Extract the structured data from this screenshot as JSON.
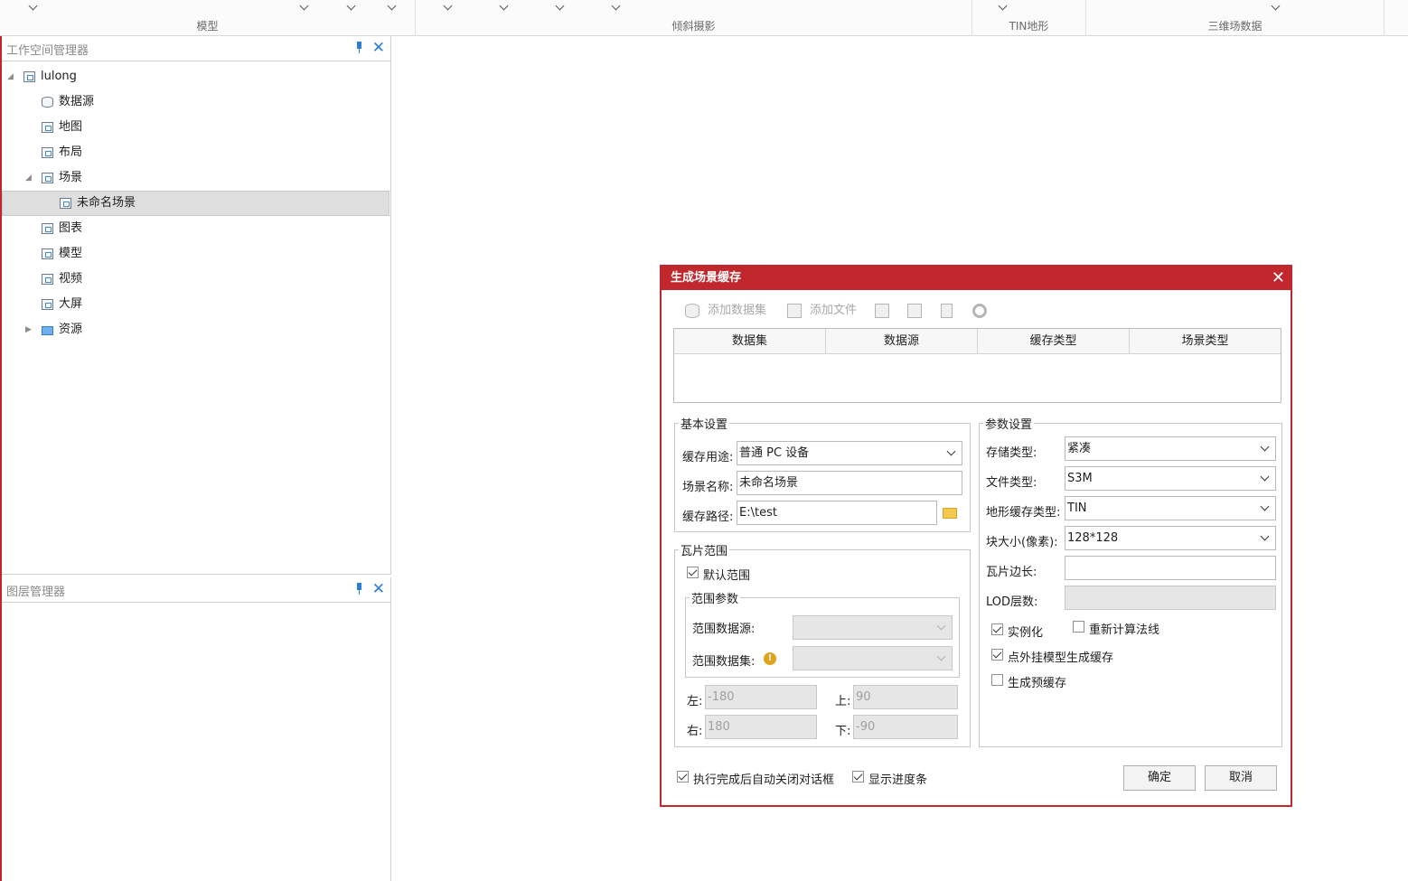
{
  "ribbon": {
    "groups": [
      {
        "label": "模型"
      },
      {
        "label": "倾斜摄影"
      },
      {
        "label": "TIN地形"
      },
      {
        "label": "三维场数据"
      }
    ]
  },
  "workspace_panel": {
    "title": "工作空间管理器",
    "items": [
      {
        "label": "lulong"
      },
      {
        "label": "数据源"
      },
      {
        "label": "地图"
      },
      {
        "label": "布局"
      },
      {
        "label": "场景"
      },
      {
        "label": "未命名场景"
      },
      {
        "label": "图表"
      },
      {
        "label": "模型"
      },
      {
        "label": "视频"
      },
      {
        "label": "大屏"
      },
      {
        "label": "资源"
      }
    ]
  },
  "layer_panel": {
    "title": "图层管理器"
  },
  "dialog": {
    "title": "生成场景缓存",
    "toolbar": {
      "add_dataset": "添加数据集",
      "add_file": "添加文件"
    },
    "grid_columns": [
      "数据集",
      "数据源",
      "缓存类型",
      "场景类型"
    ],
    "basic": {
      "legend": "基本设置",
      "usage_label": "缓存用途:",
      "usage_value": "普通 PC 设备",
      "name_label": "场景名称:",
      "name_value": "未命名场景",
      "path_label": "缓存路径:",
      "path_value": "E:\\test"
    },
    "tile": {
      "legend": "瓦片范围",
      "default_range": "默认范围",
      "range_params_legend": "范围参数",
      "range_datasource_label": "范围数据源:",
      "range_dataset_label": "范围数据集:",
      "left_label": "左:",
      "left_value": "-180",
      "top_label": "上:",
      "top_value": "90",
      "right_label": "右:",
      "right_value": "180",
      "bottom_label": "下:",
      "bottom_value": "-90"
    },
    "params": {
      "legend": "参数设置",
      "storage_label": "存储类型:",
      "storage_value": "紧凑",
      "filetype_label": "文件类型:",
      "filetype_value": "S3M",
      "terrain_label": "地形缓存类型:",
      "terrain_value": "TIN",
      "block_label": "块大小(像素):",
      "block_value": "128*128",
      "tile_edge_label": "瓦片边长:",
      "lod_label": "LOD层数:",
      "instancing": "实例化",
      "recalc_normals": "重新计算法线",
      "external_model": "点外挂模型生成缓存",
      "pre_cache": "生成预缓存"
    },
    "auto_close": "执行完成后自动关闭对话框",
    "show_progress": "显示进度条",
    "ok": "确定",
    "cancel": "取消"
  }
}
